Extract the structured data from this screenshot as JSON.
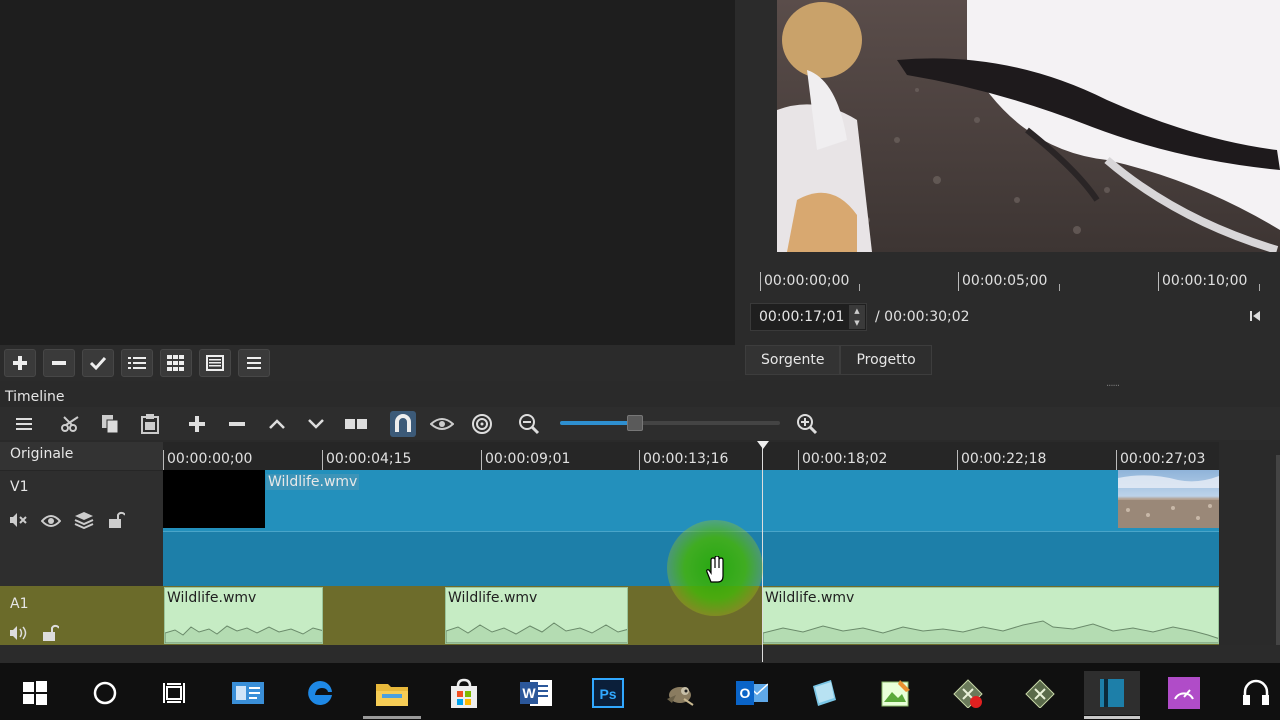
{
  "viewer": {
    "ruler_labels": [
      "00:00:00;00",
      "00:00:05;00",
      "00:00:10;00"
    ],
    "current_timecode": "00:00:17;01",
    "total_timecode": "/ 00:00:30;02",
    "tabs": [
      "Sorgente",
      "Progetto"
    ],
    "active_tab": "Sorgente"
  },
  "playlist": {
    "toolbar_icons": [
      "add-icon",
      "remove-icon",
      "check-icon",
      "list-view-icon",
      "grid-view-icon",
      "table-view-icon",
      "menu-icon"
    ]
  },
  "timeline": {
    "title": "Timeline",
    "toolbar_icons": [
      "menu-icon",
      "cut-icon",
      "copy-icon",
      "paste-icon",
      "append-icon",
      "remove-icon",
      "lift-icon",
      "overwrite-icon",
      "split-icon",
      "snap-icon",
      "scrub-icon",
      "ripple-icon",
      "zoom-out-icon",
      "zoom-in-icon"
    ],
    "zoom_level": 0.34,
    "ruler_labels": [
      "00:00:00;00",
      "00:00:04;15",
      "00:00:09;01",
      "00:00:13;16",
      "00:00:18;02",
      "00:00:22;18",
      "00:00:27;03"
    ],
    "header_label": "Originale",
    "tracks": [
      {
        "name": "V1",
        "icons": [
          "mute-icon",
          "eye-icon",
          "composite-icon",
          "lock-icon"
        ],
        "clips": [
          {
            "label": "Wildlife.wmv"
          }
        ]
      },
      {
        "name": "A1",
        "icons": [
          "speaker-icon",
          "lock-icon"
        ],
        "clips": [
          {
            "label": "Wildlife.wmv"
          },
          {
            "label": "Wildlife.wmv"
          },
          {
            "label": "Wildlife.wmv"
          }
        ]
      }
    ]
  },
  "taskbar": {
    "icons": [
      "windows-start-icon",
      "cortana-search-icon",
      "task-view-icon",
      "contacts-app-icon",
      "edge-browser-icon",
      "file-explorer-icon",
      "store-icon",
      "word-icon",
      "photoshop-icon",
      "gimp-icon",
      "outlook-icon",
      "notes-app-icon",
      "image-editor-icon",
      "media-app-icon",
      "video-app-icon",
      "shotcut-icon",
      "speedometer-app-icon",
      "headphones-icon"
    ],
    "word_letter": "W",
    "photoshop_letters": "Ps",
    "outlook_letter": "O"
  },
  "colors": {
    "video_track": "#2390bc",
    "audio_track": "#6d6c2b",
    "audio_clip": "#c6ecc4",
    "accent": "#2e8fd0"
  }
}
